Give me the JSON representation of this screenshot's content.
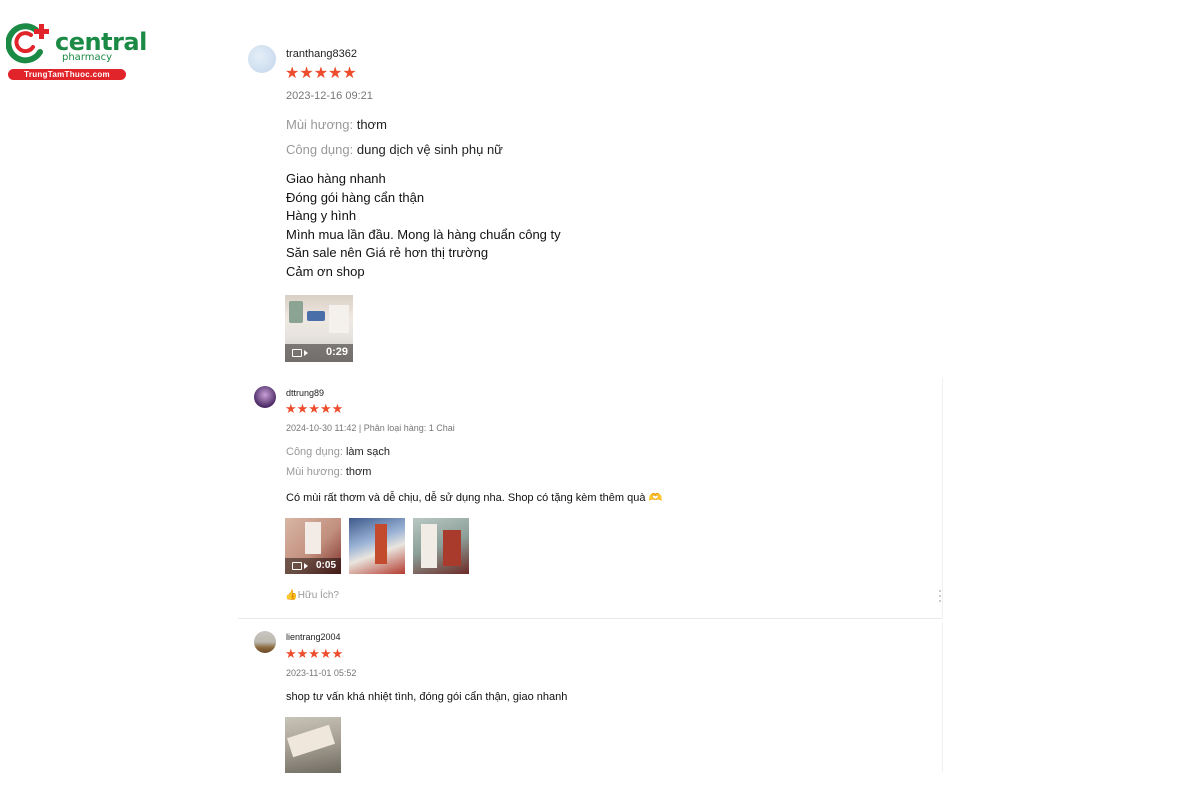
{
  "logo": {
    "word": "central",
    "sub": "pharmacy",
    "site": "TrungTamThuoc.com"
  },
  "reviews": [
    {
      "username": "tranthang8362",
      "stars": "★★★★★",
      "date": "2023-12-16 09:21",
      "attrs": [
        {
          "key": "Mùi hương:",
          "value": "thơm"
        },
        {
          "key": "Công dụng:",
          "value": "dung dịch vệ sinh phụ nữ"
        }
      ],
      "lines": [
        "Giao hàng nhanh",
        "Đóng gói hàng cẩn thận",
        "Hàng y hình",
        "Mình mua lần đầu. Mong là hàng chuẩn công ty",
        "Săn sale nên Giá rẻ hơn thị trường",
        "Cảm ơn shop"
      ],
      "video_duration": "0:29"
    },
    {
      "username": "dttrung89",
      "stars": "★★★★★",
      "date": "2024-10-30 11:42 | Phân loại hàng: 1 Chai",
      "attrs": [
        {
          "key": "Công dụng:",
          "value": "làm sạch"
        },
        {
          "key": "Mùi hương:",
          "value": "thơm"
        }
      ],
      "text": "Có mùi rất thơm và dễ chịu, dễ sử dụng nha. Shop có tặng kèm thêm quà 🫶",
      "video_duration": "0:05",
      "helpful": "Hữu Ích?"
    },
    {
      "username": "lientrang2004",
      "stars": "★★★★★",
      "date": "2023-11-01 05:52",
      "text": "shop tư vấn khá nhiệt tình, đóng gói cẩn thận, giao nhanh"
    }
  ],
  "icons": {
    "logo": "central-pharmacy-logo",
    "video": "video-camera-icon",
    "like": "thumbs-up-icon",
    "more": "more-vertical-icon"
  },
  "colors": {
    "star": "#ee4d2d",
    "brand_green": "#1a8a45",
    "brand_red": "#e0242a"
  }
}
